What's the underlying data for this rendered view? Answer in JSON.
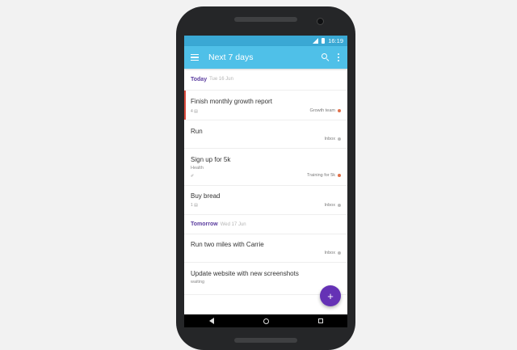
{
  "status_bar": {
    "time": "16:19"
  },
  "app_bar": {
    "title": "Next 7 days",
    "icons": [
      "menu-icon",
      "search-icon",
      "more-vert-icon"
    ]
  },
  "sections": [
    {
      "title": "Today",
      "date": "Tue 16 Jun",
      "tasks": [
        {
          "title": "Finish monthly growth report",
          "meta": "4",
          "project": "Growth team",
          "project_color": "#e0704a",
          "priority_color": "#db4c3f"
        },
        {
          "title": "Run",
          "project": "Inbox",
          "project_color": "#bdbdbd"
        },
        {
          "title": "Sign up for 5k",
          "subtitle": "Health",
          "meta": "✐",
          "project": "Training for 5k",
          "project_color": "#e0704a"
        },
        {
          "title": "Buy bread",
          "meta": "1",
          "project": "Inbox",
          "project_color": "#bdbdbd"
        }
      ]
    },
    {
      "title": "Tomorrow",
      "date": "Wed 17 Jun",
      "tasks": [
        {
          "title": "Run two miles with Carrie",
          "project": "Inbox",
          "project_color": "#bdbdbd"
        },
        {
          "title": "Update website with new screenshots",
          "subtitle": "waiting"
        }
      ]
    }
  ],
  "fab": {
    "label": "+"
  },
  "colors": {
    "status_bar": "#3aa8d4",
    "app_bar": "#4fc0e8",
    "accent": "#6532b5",
    "section_title": "#5b3d9f"
  }
}
